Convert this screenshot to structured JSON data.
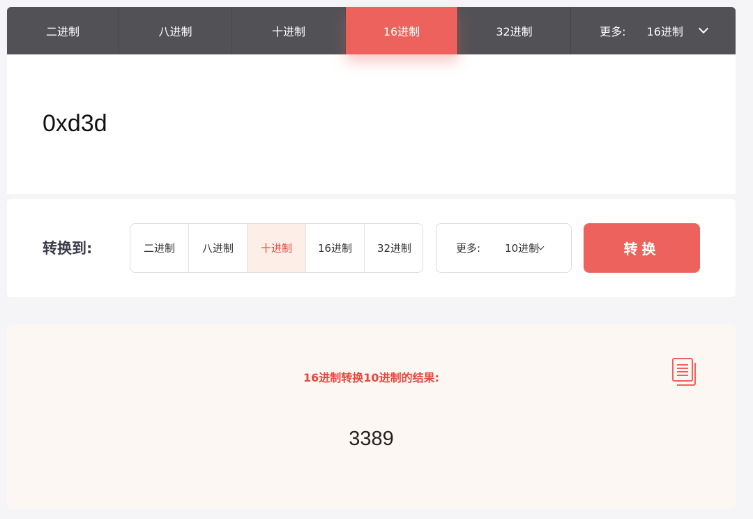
{
  "top_tabs": [
    {
      "label": "二进制"
    },
    {
      "label": "八进制"
    },
    {
      "label": "十进制"
    },
    {
      "label": "16进制"
    },
    {
      "label": "32进制"
    }
  ],
  "top_more": {
    "label": "更多:",
    "value": "16进制"
  },
  "active_tab": "16进制",
  "input": {
    "value": "0xd3d"
  },
  "convert": {
    "label": "转换到:",
    "options": [
      "二进制",
      "八进制",
      "十进制",
      "16进制",
      "32进制"
    ],
    "selected": "十进制",
    "more_label": "更多:",
    "more_value": "10进制",
    "button_label": "转换"
  },
  "result": {
    "title": "16进制转换10进制的结果:",
    "value": "3389"
  },
  "colors": {
    "accent": "#ed625c",
    "tabbar_bg": "#525256",
    "result_bg": "#fdf7f4",
    "selected_bg": "#fdeee8"
  }
}
